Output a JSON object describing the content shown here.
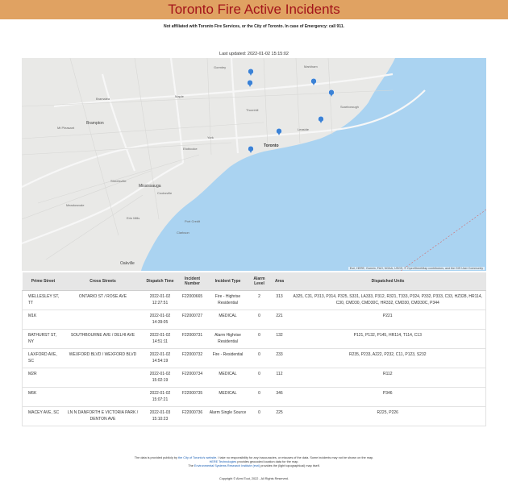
{
  "header": {
    "title": "Toronto Fire Active Incidents",
    "disclaimer": "Not affiliated with Toronto Fire Services, or the City of Toronto. In case of Emergency: call 911.",
    "last_updated": "Last updated: 2022-01-02 15:15:02"
  },
  "map": {
    "attribution": "Esri, HERE, Garmin, FAO, NOAA, USGS, © OpenStreetMap contributors, and the GIS User Community",
    "labels": {
      "toronto": "Toronto",
      "mississauga": "Mississauga",
      "brampton": "Brampton",
      "oakville": "Oakville",
      "markham": "Markham",
      "scarborough": "Scarborough",
      "york": "York",
      "etobicoke": "Etobicoke",
      "mt_pleasant": "Mt Pleasant",
      "gormley": "Gormley",
      "bramalea": "Bramalea",
      "maple": "Maple",
      "thornhill": "Thornhill",
      "leaside": "Leaside",
      "port_credit": "Port Credit",
      "clarkson": "Clarkson",
      "streetsville": "Streetsville",
      "meadowvale": "Meadowvale",
      "erin_mills": "Erin Mills",
      "cooksville": "Cooksville"
    },
    "pins": [
      {
        "name": "incident-pin"
      },
      {
        "name": "incident-pin"
      },
      {
        "name": "incident-pin"
      },
      {
        "name": "incident-pin"
      },
      {
        "name": "incident-pin"
      },
      {
        "name": "incident-pin"
      },
      {
        "name": "incident-pin"
      }
    ],
    "colors": {
      "water": "#aad3f1",
      "land": "#e9e9e7",
      "pin": "#3b82d6"
    }
  },
  "table": {
    "headers": [
      "Prime Street",
      "Cross Streets",
      "Dispatch Time",
      "Incident Number",
      "Incident Type",
      "Alarm Level",
      "Area",
      "Dispatched Units"
    ],
    "rows": [
      {
        "prime": "WELLESLEY ST, TT",
        "cross": "ONTARIO ST / ROSE AVE",
        "time": "2022-01-02 12:27:51",
        "number": "F22000665",
        "type": "Fire - Highrise Residential",
        "alarm": "2",
        "area": "313",
        "units": "A325, C31, P313, P314, P325, S331, LA333, P312, R321, T333, P324, P332, P333, C33, HZ328, HR114, C30, CMD30, CMD30C, HR332, CMD30, CMD30C, P344"
      },
      {
        "prime": "M1K",
        "cross": "",
        "time": "2022-01-02 14:39:05",
        "number": "F22000727",
        "type": "MEDICAL",
        "alarm": "0",
        "area": "221",
        "units": "P221"
      },
      {
        "prime": "BATHURST ST, NY",
        "cross": "SOUTHBOURNE AVE / DELHI AVE",
        "time": "2022-01-02 14:51:11",
        "number": "F22000731",
        "type": "Alarm Highrise Residential",
        "alarm": "0",
        "area": "132",
        "units": "P121, P132, P145, HR114, T114, C13"
      },
      {
        "prime": "LAXFORD AVE, SC",
        "cross": "WEXFORD BLVD / WEXFORD BLVD",
        "time": "2022-01-02 14:54:19",
        "number": "F22000732",
        "type": "Fire - Residential",
        "alarm": "0",
        "area": "233",
        "units": "R235, P233, A222, P232, C11, P123, S232"
      },
      {
        "prime": "M2R",
        "cross": "",
        "time": "2022-01-02 15:02:19",
        "number": "F22000734",
        "type": "MEDICAL",
        "alarm": "0",
        "area": "112",
        "units": "R112"
      },
      {
        "prime": "M6K",
        "cross": "",
        "time": "2022-01-02 15:07:21",
        "number": "F22000735",
        "type": "MEDICAL",
        "alarm": "0",
        "area": "346",
        "units": "P346"
      },
      {
        "prime": "MACEY AVE, SC",
        "cross": "LN N DANFORTH E VICTORIA PARK / DENTON AVE",
        "time": "2022-01-03 15:10:23",
        "number": "F22000736",
        "type": "Alarm Single Source",
        "alarm": "0",
        "area": "225",
        "units": "R225, P226"
      }
    ]
  },
  "footer": {
    "line1_pre": "The data is provided publicly by",
    "line1_link": "the City of Toronto's website",
    "line1_post": ". I take no responsibility for any inaccuracies, or misuses of the data. Some incidents may not be shown on the map.",
    "line2_link": "HERE Technologies",
    "line2_post": "provides geocoded location data for the map.",
    "line3_pre": "The",
    "line3_link": "Environmental Systems Research Institute (esri)",
    "line3_post": "provides the (light topographical) map itself.",
    "copyright": "Copyright © Ahmi Tout, 2022 - All Rights Reserved."
  }
}
